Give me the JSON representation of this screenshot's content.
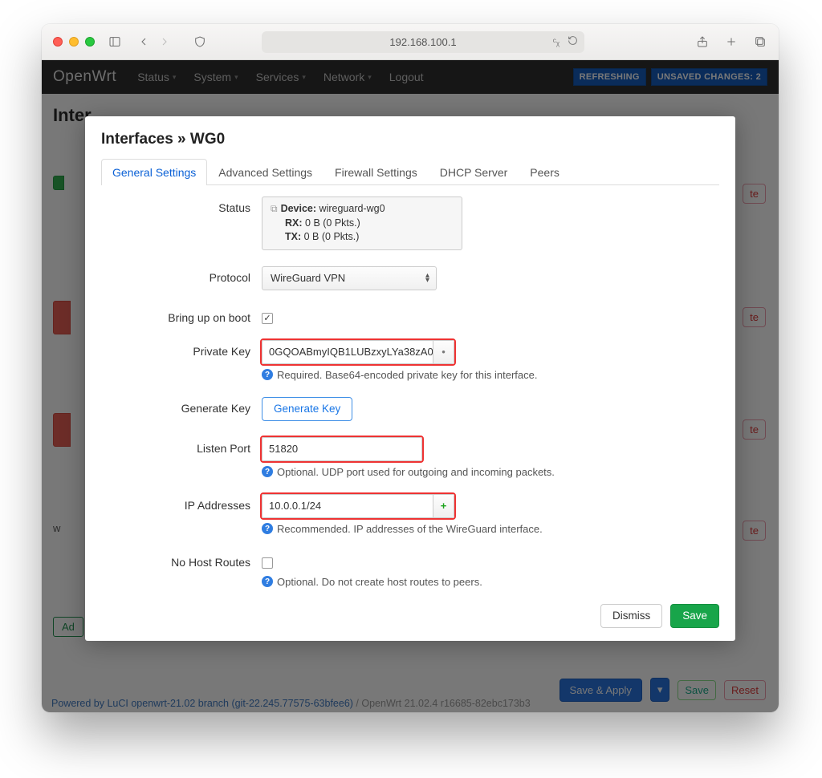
{
  "browser": {
    "address": "192.168.100.1"
  },
  "navbar": {
    "brand": "OpenWrt",
    "items": [
      "Status",
      "System",
      "Services",
      "Network",
      "Logout"
    ],
    "badge_refreshing": "REFRESHING",
    "badge_unsaved": "UNSAVED CHANGES: 2"
  },
  "page": {
    "bg_title_partial": "Inter",
    "breadcrumb": "Interfaces » WG0"
  },
  "tabs": [
    "General Settings",
    "Advanced Settings",
    "Firewall Settings",
    "DHCP Server",
    "Peers"
  ],
  "labels": {
    "status": "Status",
    "protocol": "Protocol",
    "bringup": "Bring up on boot",
    "privatekey": "Private Key",
    "generatekey": "Generate Key",
    "listenport": "Listen Port",
    "ipaddresses": "IP Addresses",
    "nohostroutes": "No Host Routes"
  },
  "status": {
    "device_label": "Device:",
    "device_value": "wireguard-wg0",
    "rx_label": "RX:",
    "rx_value": "0 B (0 Pkts.)",
    "tx_label": "TX:",
    "tx_value": "0 B (0 Pkts.)"
  },
  "fields": {
    "protocol": "WireGuard VPN",
    "bringup_checked": "✓",
    "private_key": "0GQOABmyIQB1LUBzxyLYa38zA0",
    "private_key_help": "Required. Base64-encoded private key for this interface.",
    "generate_key_btn": "Generate Key",
    "listen_port": "51820",
    "listen_port_help": "Optional. UDP port used for outgoing and incoming packets.",
    "ip_addresses": "10.0.0.1/24",
    "ip_addresses_help": "Recommended. IP addresses of the WireGuard interface.",
    "no_host_routes_help": "Optional. Do not create host routes to peers."
  },
  "buttons": {
    "dismiss": "Dismiss",
    "save": "Save",
    "save_apply": "Save & Apply",
    "reset": "Reset",
    "delete": "te",
    "add": "Ad"
  },
  "footer": {
    "link": "Powered by LuCI openwrt-21.02 branch (git-22.245.77575-63bfee6)",
    "grey": " / OpenWrt 21.02.4 r16685-82ebc173b3"
  }
}
